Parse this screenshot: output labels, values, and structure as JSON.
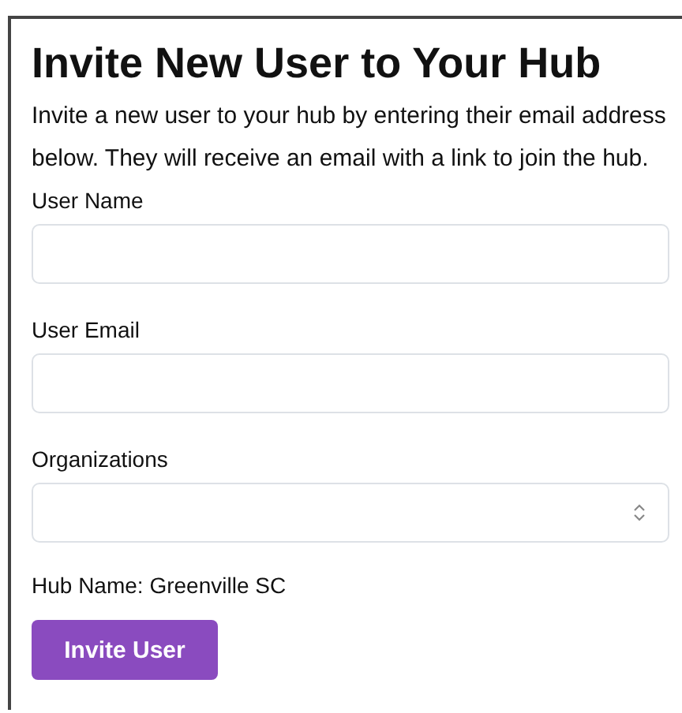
{
  "title": "Invite New User to Your Hub",
  "description": "Invite a new user to your hub by entering their email address below. They will receive an email with a link to join the hub.",
  "fields": [
    {
      "kind": "text",
      "label": "User Name"
    },
    {
      "kind": "text",
      "label": "User Email"
    },
    {
      "kind": "select",
      "label": "Organizations"
    }
  ],
  "hub_name": "Hub Name: Greenville SC",
  "submit_button": "Invite User"
}
